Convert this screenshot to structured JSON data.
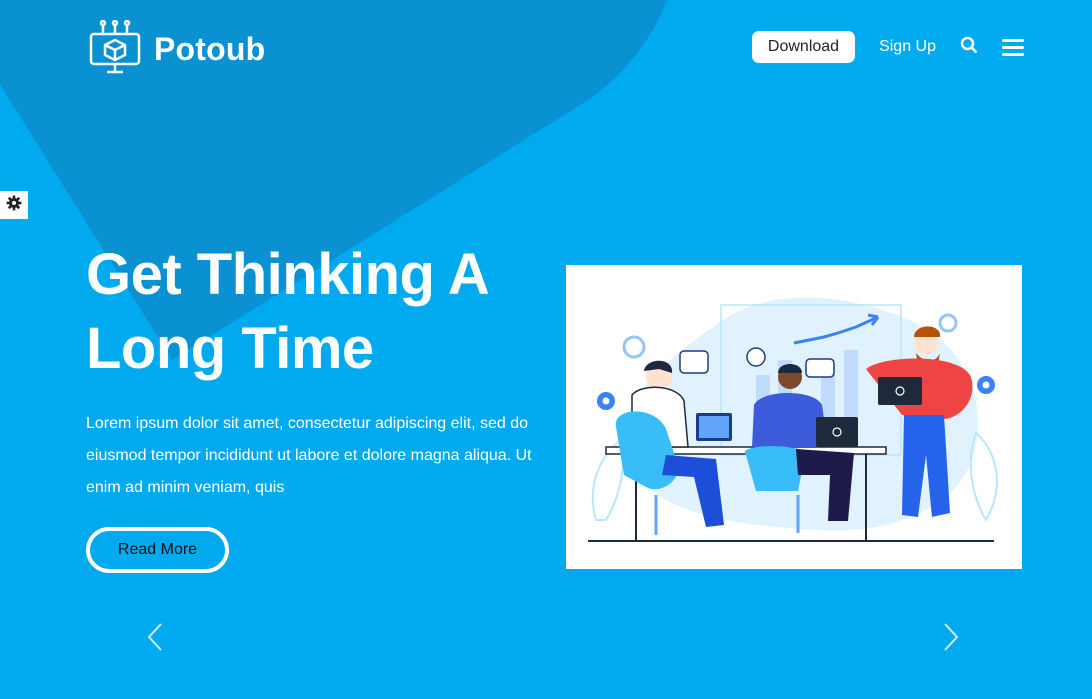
{
  "brand": {
    "name": "Potoub",
    "icon": "monitor-cube-icon"
  },
  "nav": {
    "download_label": "Download",
    "signup_label": "Sign Up",
    "search_icon": "search-icon",
    "menu_icon": "hamburger-menu-icon"
  },
  "settings": {
    "icon": "gear-icon"
  },
  "hero": {
    "title": "Get Thinking A Long Time",
    "description": "Lorem ipsum dolor sit amet, consectetur adipiscing elit, sed do eiusmod tempor incididunt ut labore et dolore magna aliqua. Ut enim ad minim veniam, quis",
    "cta_label": "Read More",
    "image": "team-meeting-illustration"
  },
  "carousel": {
    "prev_icon": "chevron-left-icon",
    "next_icon": "chevron-right-icon"
  },
  "colors": {
    "background": "#01a9ee",
    "shape": "#0a8fd0",
    "white": "#ffffff",
    "accent_red": "#ef4444",
    "accent_blue": "#3b82f6"
  }
}
